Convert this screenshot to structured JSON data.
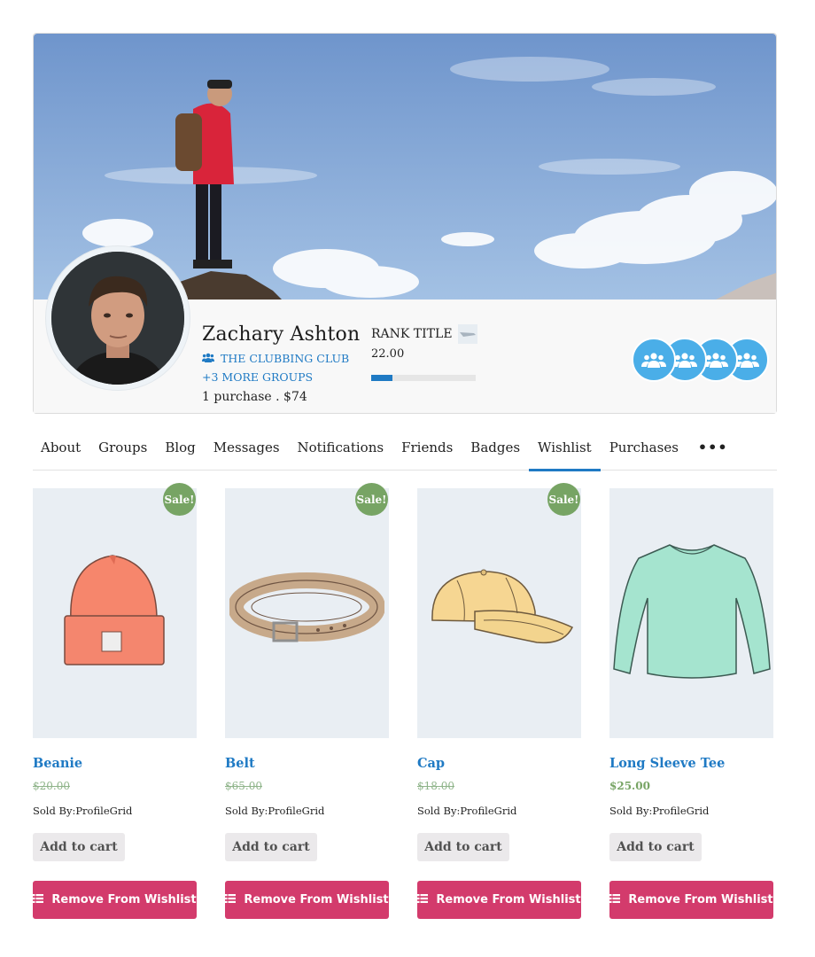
{
  "profile": {
    "name": "Zachary Ashton",
    "group_name": "THE CLUBBING CLUB",
    "more_groups": "+3 MORE GROUPS",
    "purchase_summary": "1 purchase . $74",
    "rank_title": "RANK TITLE",
    "rank_points": "22.00",
    "rank_progress_percent": 20,
    "group_icon_count": 4
  },
  "colors": {
    "accent_blue": "#1f7ac4",
    "sale_green": "#77a464",
    "remove_pink": "#d33b6c",
    "group_icon_blue": "#4aaee8"
  },
  "tabs": [
    {
      "label": "About",
      "active": false
    },
    {
      "label": "Groups",
      "active": false
    },
    {
      "label": "Blog",
      "active": false
    },
    {
      "label": "Messages",
      "active": false
    },
    {
      "label": "Notifications",
      "active": false
    },
    {
      "label": "Friends",
      "active": false
    },
    {
      "label": "Badges",
      "active": false
    },
    {
      "label": "Wishlist",
      "active": true
    },
    {
      "label": "Purchases",
      "active": false
    }
  ],
  "tabs_more": "•••",
  "products": [
    {
      "title": "Beanie",
      "sale_badge": "Sale!",
      "old_price": "$20.00",
      "price": "",
      "sold_by": "Sold By:ProfileGrid",
      "cart_label": "Add to cart",
      "remove_label": "Remove From Wishlist",
      "icon": "beanie-image"
    },
    {
      "title": "Belt",
      "sale_badge": "Sale!",
      "old_price": "$65.00",
      "price": "",
      "sold_by": "Sold By:ProfileGrid",
      "cart_label": "Add to cart",
      "remove_label": "Remove From Wishlist",
      "icon": "belt-image"
    },
    {
      "title": "Cap",
      "sale_badge": "Sale!",
      "old_price": "$18.00",
      "price": "",
      "sold_by": "Sold By:ProfileGrid",
      "cart_label": "Add to cart",
      "remove_label": "Remove From Wishlist",
      "icon": "cap-image"
    },
    {
      "title": "Long Sleeve Tee",
      "sale_badge": "",
      "old_price": "",
      "price": "$25.00",
      "sold_by": "Sold By:ProfileGrid",
      "cart_label": "Add to cart",
      "remove_label": "Remove From Wishlist",
      "icon": "long-sleeve-tee-image"
    }
  ]
}
